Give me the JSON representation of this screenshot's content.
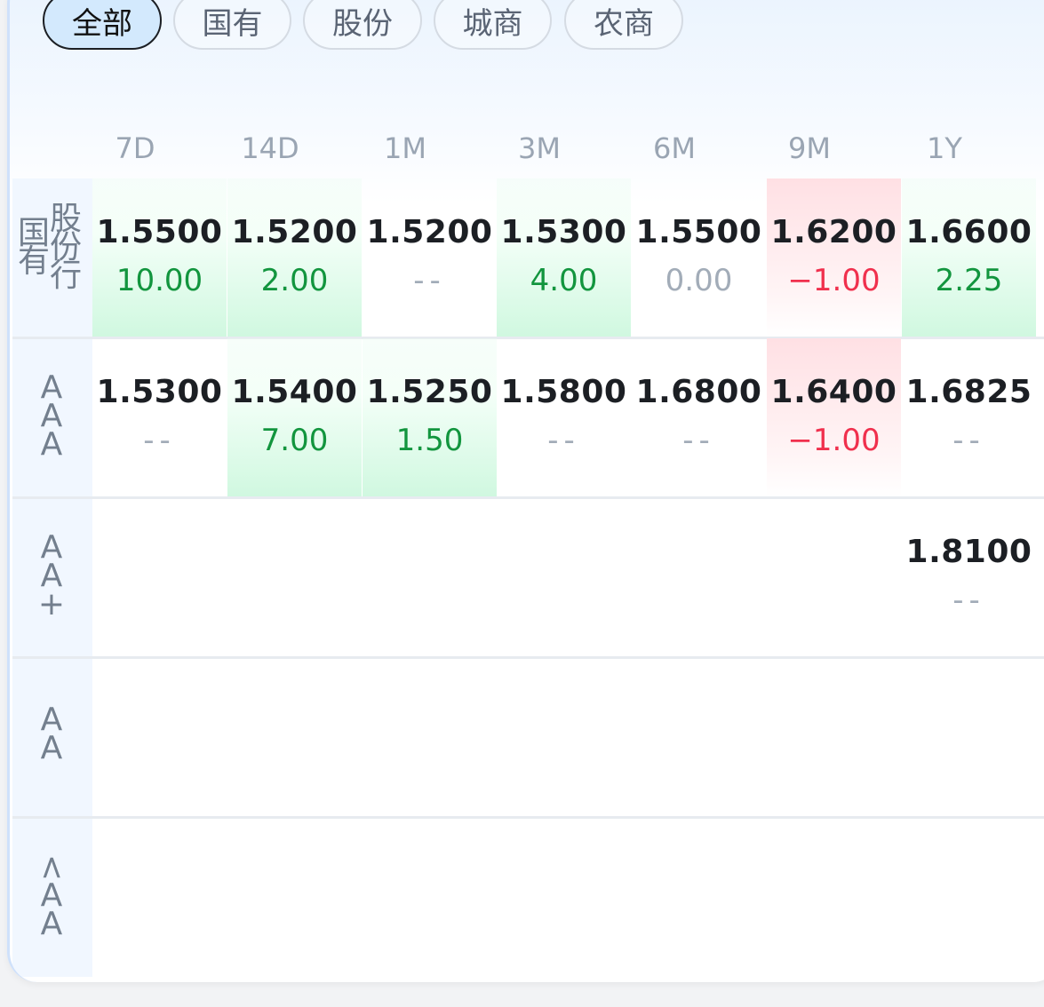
{
  "filters": {
    "items": [
      "全部",
      "国有",
      "股份",
      "城商",
      "农商"
    ],
    "active": 0
  },
  "tenors": [
    "7D",
    "14D",
    "1M",
    "3M",
    "6M",
    "9M",
    "1Y"
  ],
  "rows": [
    {
      "label_left": [
        "国",
        "有"
      ],
      "label_right": [
        "股",
        "份",
        "行"
      ],
      "cells": [
        {
          "rate": "1.5500",
          "change": "10.00",
          "trend": "up"
        },
        {
          "rate": "1.5200",
          "change": "2.00",
          "trend": "up"
        },
        {
          "rate": "1.5200",
          "change": "--",
          "trend": "none"
        },
        {
          "rate": "1.5300",
          "change": "4.00",
          "trend": "up"
        },
        {
          "rate": "1.5500",
          "change": "0.00",
          "trend": "flat"
        },
        {
          "rate": "1.6200",
          "change": "−1.00",
          "trend": "down"
        },
        {
          "rate": "1.6600",
          "change": "2.25",
          "trend": "up"
        }
      ]
    },
    {
      "label": [
        "A",
        "A",
        "A"
      ],
      "cells": [
        {
          "rate": "1.5300",
          "change": "--",
          "trend": "none"
        },
        {
          "rate": "1.5400",
          "change": "7.00",
          "trend": "up"
        },
        {
          "rate": "1.5250",
          "change": "1.50",
          "trend": "up"
        },
        {
          "rate": "1.5800",
          "change": "--",
          "trend": "none"
        },
        {
          "rate": "1.6800",
          "change": "--",
          "trend": "none"
        },
        {
          "rate": "1.6400",
          "change": "−1.00",
          "trend": "down"
        },
        {
          "rate": "1.6825",
          "change": "--",
          "trend": "none"
        }
      ]
    },
    {
      "label": [
        "A",
        "A",
        "+"
      ],
      "cells": [
        null,
        null,
        null,
        null,
        null,
        null,
        {
          "rate": "1.8100",
          "change": "--",
          "trend": "none"
        }
      ]
    },
    {
      "label": [
        "A",
        "A"
      ],
      "cells": [
        null,
        null,
        null,
        null,
        null,
        null,
        null
      ]
    },
    {
      "label": [
        "<",
        "A",
        "A"
      ],
      "cells": [
        null,
        null,
        null,
        null,
        null,
        null,
        null
      ]
    }
  ],
  "colors": {
    "up": "#12953e",
    "down": "#f0304d",
    "active_tab_bg": "#d3e9fd"
  }
}
